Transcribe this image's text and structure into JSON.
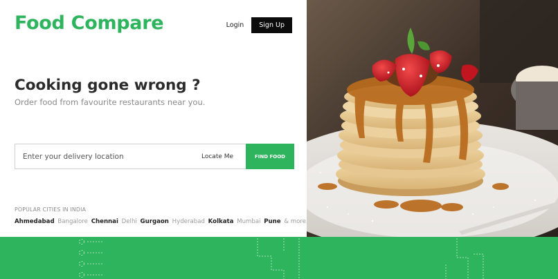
{
  "brand": {
    "name": "Food Compare"
  },
  "nav": {
    "login": "Login",
    "signup": "Sign Up"
  },
  "hero": {
    "headline": "Cooking gone wrong ?",
    "tagline": "Order food from favourite restaurants near you."
  },
  "search": {
    "placeholder": "Enter your delivery location",
    "locate_label": "Locate Me",
    "find_label": "FIND FOOD"
  },
  "cities": {
    "title": "POPULAR CITIES IN INDIA",
    "items": [
      {
        "name": "Ahmedabad",
        "style": "bold"
      },
      {
        "name": "Bangalore",
        "style": "light"
      },
      {
        "name": "Chennai",
        "style": "bold"
      },
      {
        "name": "Delhi",
        "style": "light"
      },
      {
        "name": "Gurgaon",
        "style": "bold"
      },
      {
        "name": "Hyderabad",
        "style": "light"
      },
      {
        "name": "Kolkata",
        "style": "bold"
      },
      {
        "name": "Mumbai",
        "style": "light"
      },
      {
        "name": "Pune",
        "style": "bold"
      },
      {
        "name": "& more.",
        "style": "light"
      }
    ]
  },
  "colors": {
    "accent": "#2db45d",
    "dark": "#0c0c0c"
  }
}
